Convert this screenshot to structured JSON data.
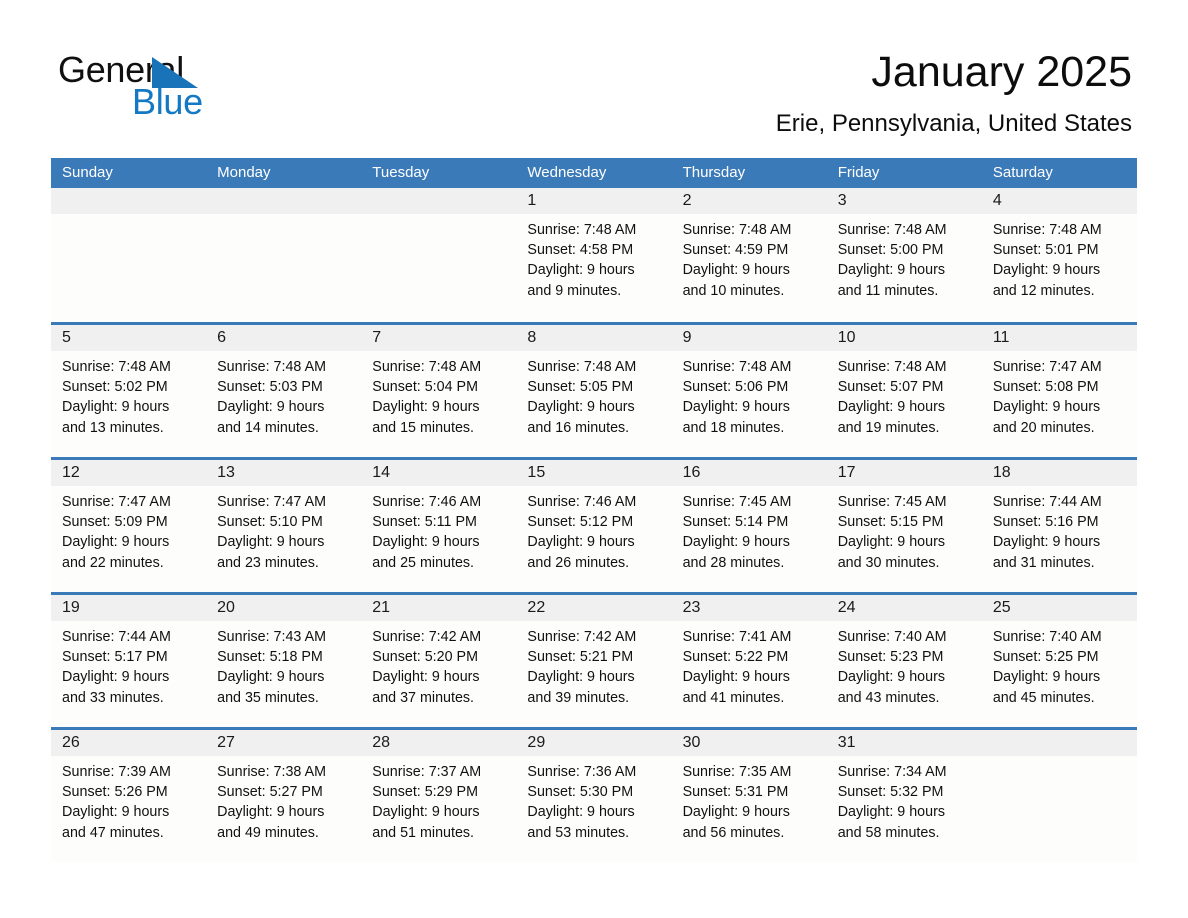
{
  "brand": {
    "logo_line1": "General",
    "logo_line2": "Blue",
    "triangle_icon": "blue-triangle-icon",
    "accent_color": "#1479c4"
  },
  "header": {
    "month_title": "January 2025",
    "location": "Erie, Pennsylvania, United States"
  },
  "colors": {
    "header_blue": "#3b7ab8",
    "daynum_band": "#f0f0f0",
    "cell_background": "#fdfdfb",
    "page_background": "#ffffff"
  },
  "weekdays": [
    "Sunday",
    "Monday",
    "Tuesday",
    "Wednesday",
    "Thursday",
    "Friday",
    "Saturday"
  ],
  "weeks": [
    [
      {
        "day": "",
        "lines": []
      },
      {
        "day": "",
        "lines": []
      },
      {
        "day": "",
        "lines": []
      },
      {
        "day": "1",
        "lines": [
          "Sunrise: 7:48 AM",
          "Sunset: 4:58 PM",
          "Daylight: 9 hours",
          "and 9 minutes."
        ]
      },
      {
        "day": "2",
        "lines": [
          "Sunrise: 7:48 AM",
          "Sunset: 4:59 PM",
          "Daylight: 9 hours",
          "and 10 minutes."
        ]
      },
      {
        "day": "3",
        "lines": [
          "Sunrise: 7:48 AM",
          "Sunset: 5:00 PM",
          "Daylight: 9 hours",
          "and 11 minutes."
        ]
      },
      {
        "day": "4",
        "lines": [
          "Sunrise: 7:48 AM",
          "Sunset: 5:01 PM",
          "Daylight: 9 hours",
          "and 12 minutes."
        ]
      }
    ],
    [
      {
        "day": "5",
        "lines": [
          "Sunrise: 7:48 AM",
          "Sunset: 5:02 PM",
          "Daylight: 9 hours",
          "and 13 minutes."
        ]
      },
      {
        "day": "6",
        "lines": [
          "Sunrise: 7:48 AM",
          "Sunset: 5:03 PM",
          "Daylight: 9 hours",
          "and 14 minutes."
        ]
      },
      {
        "day": "7",
        "lines": [
          "Sunrise: 7:48 AM",
          "Sunset: 5:04 PM",
          "Daylight: 9 hours",
          "and 15 minutes."
        ]
      },
      {
        "day": "8",
        "lines": [
          "Sunrise: 7:48 AM",
          "Sunset: 5:05 PM",
          "Daylight: 9 hours",
          "and 16 minutes."
        ]
      },
      {
        "day": "9",
        "lines": [
          "Sunrise: 7:48 AM",
          "Sunset: 5:06 PM",
          "Daylight: 9 hours",
          "and 18 minutes."
        ]
      },
      {
        "day": "10",
        "lines": [
          "Sunrise: 7:48 AM",
          "Sunset: 5:07 PM",
          "Daylight: 9 hours",
          "and 19 minutes."
        ]
      },
      {
        "day": "11",
        "lines": [
          "Sunrise: 7:47 AM",
          "Sunset: 5:08 PM",
          "Daylight: 9 hours",
          "and 20 minutes."
        ]
      }
    ],
    [
      {
        "day": "12",
        "lines": [
          "Sunrise: 7:47 AM",
          "Sunset: 5:09 PM",
          "Daylight: 9 hours",
          "and 22 minutes."
        ]
      },
      {
        "day": "13",
        "lines": [
          "Sunrise: 7:47 AM",
          "Sunset: 5:10 PM",
          "Daylight: 9 hours",
          "and 23 minutes."
        ]
      },
      {
        "day": "14",
        "lines": [
          "Sunrise: 7:46 AM",
          "Sunset: 5:11 PM",
          "Daylight: 9 hours",
          "and 25 minutes."
        ]
      },
      {
        "day": "15",
        "lines": [
          "Sunrise: 7:46 AM",
          "Sunset: 5:12 PM",
          "Daylight: 9 hours",
          "and 26 minutes."
        ]
      },
      {
        "day": "16",
        "lines": [
          "Sunrise: 7:45 AM",
          "Sunset: 5:14 PM",
          "Daylight: 9 hours",
          "and 28 minutes."
        ]
      },
      {
        "day": "17",
        "lines": [
          "Sunrise: 7:45 AM",
          "Sunset: 5:15 PM",
          "Daylight: 9 hours",
          "and 30 minutes."
        ]
      },
      {
        "day": "18",
        "lines": [
          "Sunrise: 7:44 AM",
          "Sunset: 5:16 PM",
          "Daylight: 9 hours",
          "and 31 minutes."
        ]
      }
    ],
    [
      {
        "day": "19",
        "lines": [
          "Sunrise: 7:44 AM",
          "Sunset: 5:17 PM",
          "Daylight: 9 hours",
          "and 33 minutes."
        ]
      },
      {
        "day": "20",
        "lines": [
          "Sunrise: 7:43 AM",
          "Sunset: 5:18 PM",
          "Daylight: 9 hours",
          "and 35 minutes."
        ]
      },
      {
        "day": "21",
        "lines": [
          "Sunrise: 7:42 AM",
          "Sunset: 5:20 PM",
          "Daylight: 9 hours",
          "and 37 minutes."
        ]
      },
      {
        "day": "22",
        "lines": [
          "Sunrise: 7:42 AM",
          "Sunset: 5:21 PM",
          "Daylight: 9 hours",
          "and 39 minutes."
        ]
      },
      {
        "day": "23",
        "lines": [
          "Sunrise: 7:41 AM",
          "Sunset: 5:22 PM",
          "Daylight: 9 hours",
          "and 41 minutes."
        ]
      },
      {
        "day": "24",
        "lines": [
          "Sunrise: 7:40 AM",
          "Sunset: 5:23 PM",
          "Daylight: 9 hours",
          "and 43 minutes."
        ]
      },
      {
        "day": "25",
        "lines": [
          "Sunrise: 7:40 AM",
          "Sunset: 5:25 PM",
          "Daylight: 9 hours",
          "and 45 minutes."
        ]
      }
    ],
    [
      {
        "day": "26",
        "lines": [
          "Sunrise: 7:39 AM",
          "Sunset: 5:26 PM",
          "Daylight: 9 hours",
          "and 47 minutes."
        ]
      },
      {
        "day": "27",
        "lines": [
          "Sunrise: 7:38 AM",
          "Sunset: 5:27 PM",
          "Daylight: 9 hours",
          "and 49 minutes."
        ]
      },
      {
        "day": "28",
        "lines": [
          "Sunrise: 7:37 AM",
          "Sunset: 5:29 PM",
          "Daylight: 9 hours",
          "and 51 minutes."
        ]
      },
      {
        "day": "29",
        "lines": [
          "Sunrise: 7:36 AM",
          "Sunset: 5:30 PM",
          "Daylight: 9 hours",
          "and 53 minutes."
        ]
      },
      {
        "day": "30",
        "lines": [
          "Sunrise: 7:35 AM",
          "Sunset: 5:31 PM",
          "Daylight: 9 hours",
          "and 56 minutes."
        ]
      },
      {
        "day": "31",
        "lines": [
          "Sunrise: 7:34 AM",
          "Sunset: 5:32 PM",
          "Daylight: 9 hours",
          "and 58 minutes."
        ]
      },
      {
        "day": "",
        "lines": []
      }
    ]
  ]
}
